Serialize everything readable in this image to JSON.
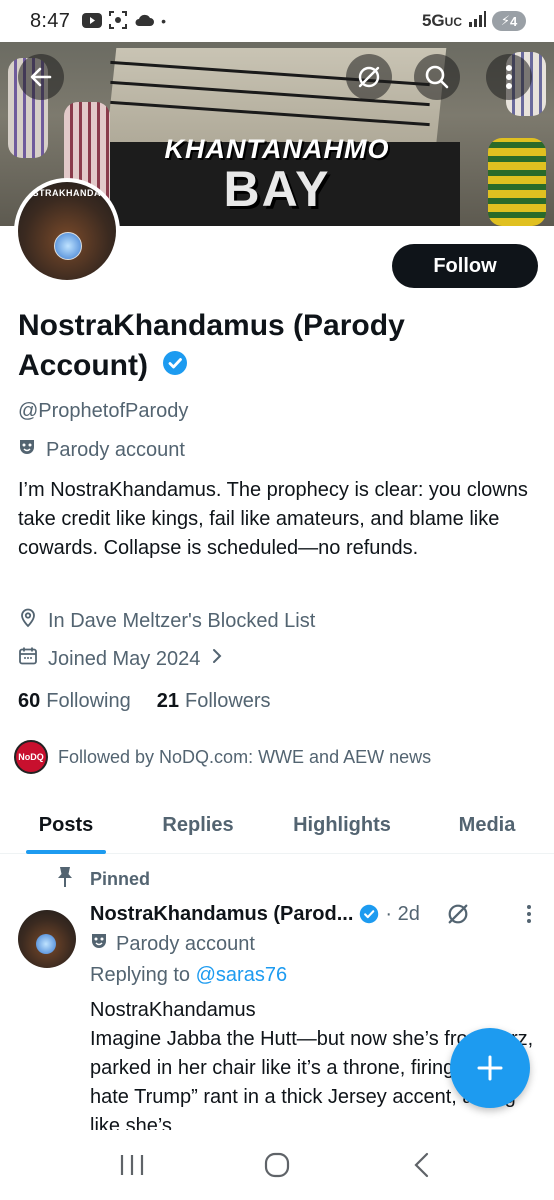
{
  "status_bar": {
    "time": "8:47",
    "network": "5G",
    "network_sub": "UC",
    "battery": "4"
  },
  "banner": {
    "line1": "KHANTANAHMO",
    "line2": "BAY"
  },
  "avatar": {
    "text": "NOSTRAKHANDAMUS"
  },
  "profile": {
    "follow_label": "Follow",
    "display_name": "NostraKhandamus (Parody Account)",
    "handle": "@ProphetofParody",
    "parody_label": "Parody account",
    "bio": "I’m NostraKhandamus. The prophecy is clear: you clowns take credit like kings, fail like amateurs, and blame like cowards. Collapse is scheduled—no refunds.",
    "location": "In Dave Meltzer's Blocked List",
    "joined": "Joined May 2024",
    "following_count": "60",
    "following_label": "Following",
    "followers_count": "21",
    "followers_label": "Followers",
    "followed_by": "Followed by NoDQ.com: WWE and AEW news",
    "followed_by_avatar": "NoDQ"
  },
  "tabs": [
    {
      "label": "Posts",
      "active": true
    },
    {
      "label": "Replies",
      "active": false
    },
    {
      "label": "Highlights",
      "active": false
    },
    {
      "label": "Media",
      "active": false
    }
  ],
  "post": {
    "pinned_label": "Pinned",
    "name": "NostraKhandamus (Parod...",
    "time": "· 2d",
    "parody_label": "Parody account",
    "replying_prefix": "Replying to",
    "replying_to": "@saras76",
    "body_line1": "NostraKhandamus",
    "body_line2": "Imagine Jabba the Hutt—but now she’s from Jerz, parked in her chair like it’s a throne, firing off an “I hate Trump” rant in a thick Jersey accent, acting like she’s"
  },
  "colors": {
    "accent": "#1d9bf0",
    "text_primary": "#0f1419",
    "text_secondary": "#536471",
    "follow_bg": "#0f1419"
  }
}
